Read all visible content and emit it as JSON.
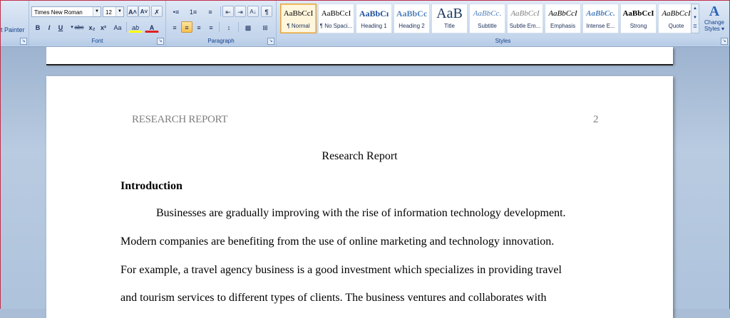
{
  "ribbon": {
    "clipboard": {
      "format_painter": "t Painter"
    },
    "font": {
      "group_label": "Font",
      "font_name": "Times New Roman",
      "font_size": "12",
      "grow": "A˄",
      "shrink": "A˅",
      "clear": "✗",
      "bold": "B",
      "italic": "I",
      "underline": "U",
      "strike": "abc",
      "subscript": "x₂",
      "superscript": "x²",
      "change_case": "Aa",
      "highlight": "ab",
      "font_color": "A"
    },
    "paragraph": {
      "group_label": "Paragraph",
      "bullets": "•≡",
      "numbering": "1≡",
      "multilevel": "≡",
      "decrease_indent": "⇤",
      "increase_indent": "⇥",
      "sort": "A↓",
      "show_marks": "¶",
      "align_left": "≡",
      "align_center": "≡",
      "align_right": "≡",
      "justify": "≡",
      "line_spacing": "↕",
      "shading": "▩",
      "borders": "⊞"
    },
    "styles": {
      "group_label": "Styles",
      "items": [
        {
          "sample": "AaBbCcI",
          "name": "¶ Normal",
          "selected": true
        },
        {
          "sample": "AaBbCcI",
          "name": "¶ No Spaci..."
        },
        {
          "sample": "AaBbCı",
          "name": "Heading 1"
        },
        {
          "sample": "AaBbCc",
          "name": "Heading 2"
        },
        {
          "sample": "AaB",
          "name": "Title"
        },
        {
          "sample": "AaBbCc.",
          "name": "Subtitle"
        },
        {
          "sample": "AaBbCcI",
          "name": "Subtle Em..."
        },
        {
          "sample": "AaBbCcI",
          "name": "Emphasis"
        },
        {
          "sample": "AaBbCc.",
          "name": "Intense E..."
        },
        {
          "sample": "AaBbCcI",
          "name": "Strong"
        },
        {
          "sample": "AaBbCcI",
          "name": "Quote"
        }
      ],
      "change_styles": "Change Styles ▾",
      "change_styles_icon": "A"
    }
  },
  "document": {
    "header": "RESEARCH REPORT",
    "page_number": "2",
    "title": "Research Report",
    "heading": "Introduction",
    "lines": [
      "Businesses are gradually improving with the rise of information technology development.",
      "Modern companies are benefiting from the use of online marketing and technology innovation.",
      "For example, a travel agency business is a good investment which specializes in providing travel",
      "and tourism services to different types of clients. The business ventures and collaborates with"
    ]
  },
  "colors": {
    "highlight_bar": "#ffff00",
    "font_color_bar": "#e02020",
    "selected_style_border": "#e3a341",
    "heading_blue": "#1f4e9a"
  }
}
